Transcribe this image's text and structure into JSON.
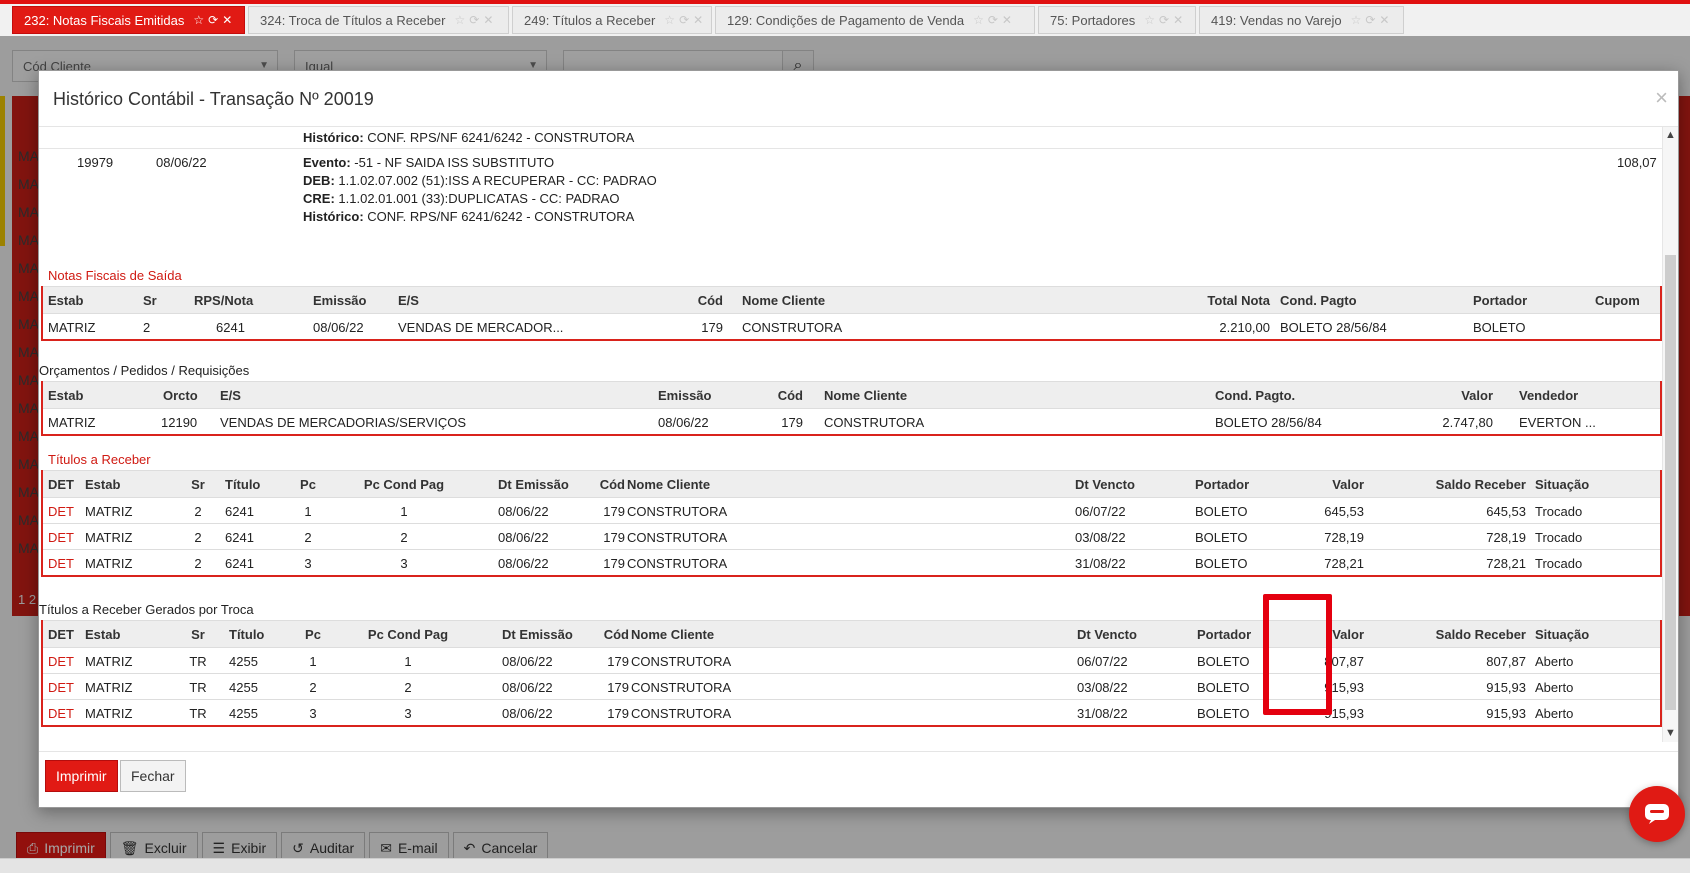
{
  "tabs": [
    {
      "label": "232: Notas Fiscais Emitidas",
      "active": true
    },
    {
      "label": "324: Troca de Títulos a Receber",
      "active": false
    },
    {
      "label": "249: Títulos a Receber",
      "active": false
    },
    {
      "label": "129: Condições de Pagamento de Venda",
      "active": false
    },
    {
      "label": "75: Portadores",
      "active": false
    },
    {
      "label": "419: Vendas no Varejo",
      "active": false
    }
  ],
  "background": {
    "filter_field": "Cód Cliente",
    "filter_operator": "Igual",
    "row_prefix": "MA",
    "pager": "1 2",
    "toolbar": {
      "print": "Imprimir",
      "delete": "Excluir",
      "view": "Exibir",
      "audit": "Auditar",
      "email": "E-mail",
      "cancel": "Cancelar"
    }
  },
  "modal": {
    "title": "Histórico Contábil - Transação Nº 20019",
    "close": "×",
    "events": {
      "prev_historico_label": "Histórico:",
      "prev_historico_value": "CONF. RPS/NF 6241/6242 - CONSTRUTORA",
      "id": "19979",
      "date": "08/06/22",
      "evento_label": "Evento:",
      "evento_value": "-51 - NF SAIDA ISS SUBSTITUTO",
      "deb_label": "DEB:",
      "deb_value": "1.1.02.07.002 (51):ISS A RECUPERAR - CC: PADRAO",
      "cre_label": "CRE:",
      "cre_value": "1.1.02.01.001 (33):DUPLICATAS - CC: PADRAO",
      "historico_label": "Histórico:",
      "historico_value": "CONF. RPS/NF 6241/6242 - CONSTRUTORA",
      "amount": "108,07"
    },
    "nf_saida": {
      "title": "Notas Fiscais de Saída",
      "headers": {
        "estab": "Estab",
        "sr": "Sr",
        "nota": "RPS/Nota",
        "emissao": "Emissão",
        "es": "E/S",
        "cod": "Cód",
        "cliente": "Nome Cliente",
        "total": "Total Nota",
        "cond": "Cond. Pagto",
        "portador": "Portador",
        "cupom": "Cupom"
      },
      "rows": [
        {
          "estab": "MATRIZ",
          "sr": "2",
          "nota": "6241",
          "emissao": "08/06/22",
          "es": "VENDAS DE MERCADOR...",
          "cod": "179",
          "cliente": "CONSTRUTORA",
          "total": "2.210,00",
          "cond": "BOLETO 28/56/84",
          "portador": "BOLETO",
          "cupom": ""
        }
      ]
    },
    "orcamentos": {
      "title": "Orçamentos / Pedidos / Requisições",
      "headers": {
        "estab": "Estab",
        "orcto": "Orcto",
        "es": "E/S",
        "emissao": "Emissão",
        "cod": "Cód",
        "cliente": "Nome Cliente",
        "cond": "Cond. Pagto.",
        "valor": "Valor",
        "vendedor": "Vendedor"
      },
      "rows": [
        {
          "estab": "MATRIZ",
          "orcto": "12190",
          "es": "VENDAS DE MERCADORIAS/SERVIÇOS",
          "emissao": "08/06/22",
          "cod": "179",
          "cliente": "CONSTRUTORA",
          "cond": "BOLETO 28/56/84",
          "valor": "2.747,80",
          "vendedor": "EVERTON ..."
        }
      ]
    },
    "titulos": {
      "title": "Títulos a Receber",
      "headers": {
        "det": "DET",
        "estab": "Estab",
        "sr": "Sr",
        "titulo": "Título",
        "pc": "Pc",
        "pccond": "Pc Cond Pag",
        "dtemissao": "Dt Emissão",
        "cod": "Cód",
        "cliente": "Nome Cliente",
        "dtvencto": "Dt Vencto",
        "portador": "Portador",
        "valor": "Valor",
        "saldo": "Saldo Receber",
        "situacao": "Situação"
      },
      "rows": [
        {
          "det": "DET",
          "estab": "MATRIZ",
          "sr": "2",
          "titulo": "6241",
          "pc": "1",
          "pccond": "1",
          "dtemissao": "08/06/22",
          "cod": "179",
          "cliente": "CONSTRUTORA",
          "dtvencto": "06/07/22",
          "portador": "BOLETO",
          "valor": "645,53",
          "saldo": "645,53",
          "situacao": "Trocado"
        },
        {
          "det": "DET",
          "estab": "MATRIZ",
          "sr": "2",
          "titulo": "6241",
          "pc": "2",
          "pccond": "2",
          "dtemissao": "08/06/22",
          "cod": "179",
          "cliente": "CONSTRUTORA",
          "dtvencto": "03/08/22",
          "portador": "BOLETO",
          "valor": "728,19",
          "saldo": "728,19",
          "situacao": "Trocado"
        },
        {
          "det": "DET",
          "estab": "MATRIZ",
          "sr": "2",
          "titulo": "6241",
          "pc": "3",
          "pccond": "3",
          "dtemissao": "08/06/22",
          "cod": "179",
          "cliente": "CONSTRUTORA",
          "dtvencto": "31/08/22",
          "portador": "BOLETO",
          "valor": "728,21",
          "saldo": "728,21",
          "situacao": "Trocado"
        }
      ]
    },
    "titulos_troca": {
      "title": "Títulos a Receber Gerados por Troca",
      "headers": {
        "det": "DET",
        "estab": "Estab",
        "sr": "Sr",
        "titulo": "Título",
        "pc": "Pc",
        "pccond": "Pc Cond Pag",
        "dtemissao": "Dt Emissão",
        "cod": "Cód",
        "cliente": "Nome Cliente",
        "dtvencto": "Dt Vencto",
        "portador": "Portador",
        "valor": "Valor",
        "saldo": "Saldo Receber",
        "situacao": "Situação"
      },
      "rows": [
        {
          "det": "DET",
          "estab": "MATRIZ",
          "sr": "TR",
          "titulo": "4255",
          "pc": "1",
          "pccond": "1",
          "dtemissao": "08/06/22",
          "cod": "179",
          "cliente": "CONSTRUTORA",
          "dtvencto": "06/07/22",
          "portador": "BOLETO",
          "valor": "807,87",
          "saldo": "807,87",
          "situacao": "Aberto"
        },
        {
          "det": "DET",
          "estab": "MATRIZ",
          "sr": "TR",
          "titulo": "4255",
          "pc": "2",
          "pccond": "2",
          "dtemissao": "08/06/22",
          "cod": "179",
          "cliente": "CONSTRUTORA",
          "dtvencto": "03/08/22",
          "portador": "BOLETO",
          "valor": "915,93",
          "saldo": "915,93",
          "situacao": "Aberto"
        },
        {
          "det": "DET",
          "estab": "MATRIZ",
          "sr": "TR",
          "titulo": "4255",
          "pc": "3",
          "pccond": "3",
          "dtemissao": "08/06/22",
          "cod": "179",
          "cliente": "CONSTRUTORA",
          "dtvencto": "31/08/22",
          "portador": "BOLETO",
          "valor": "915,93",
          "saldo": "915,93",
          "situacao": "Aberto"
        }
      ]
    },
    "footer": {
      "print": "Imprimir",
      "close": "Fechar"
    }
  },
  "colors": {
    "accent": "#e11a14",
    "section_title": "#d01a12",
    "highlight": "#e4000f"
  }
}
